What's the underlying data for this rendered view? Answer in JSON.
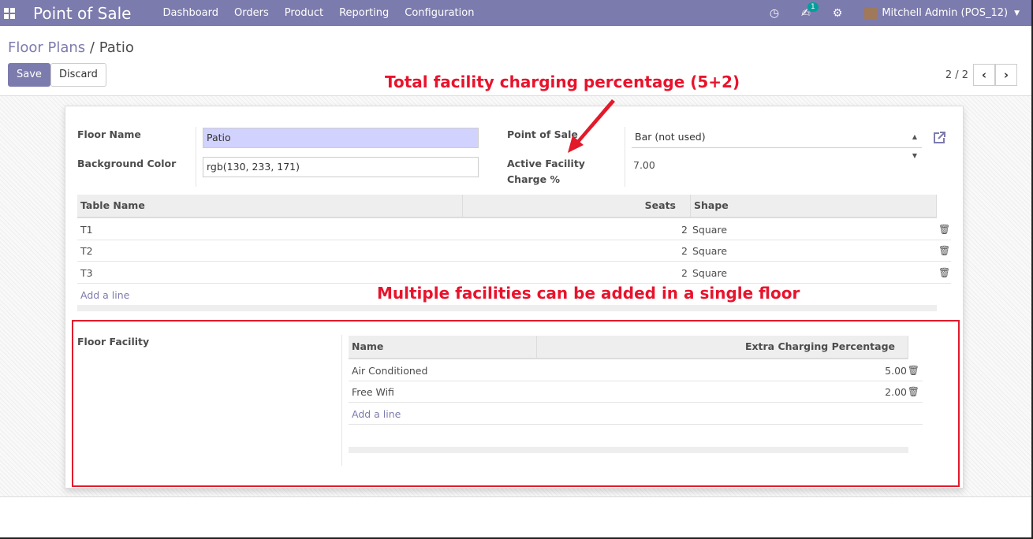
{
  "navbar": {
    "app_title": "Point of Sale",
    "menu": [
      "Dashboard",
      "Orders",
      "Product",
      "Reporting",
      "Configuration"
    ],
    "chat_badge": "1",
    "user": "Mitchell Admin (POS_12)"
  },
  "breadcrumb": {
    "parent": "Floor Plans",
    "separator": "/",
    "current": "Patio"
  },
  "buttons": {
    "save": "Save",
    "discard": "Discard"
  },
  "pager": {
    "value": "2 / 2"
  },
  "form": {
    "floor_name_label": "Floor Name",
    "floor_name_value": "Patio",
    "bg_color_label": "Background Color",
    "bg_color_value": "rgb(130, 233, 171)",
    "pos_label": "Point of Sale",
    "pos_value": "Bar (not used)",
    "active_facility_label_1": "Active Facility",
    "active_facility_label_2": "Charge %",
    "active_facility_value": "7.00",
    "floor_facility_label": "Floor Facility"
  },
  "tables": {
    "headers": {
      "name": "Table Name",
      "seats": "Seats",
      "shape": "Shape"
    },
    "rows": [
      {
        "name": "T1",
        "seats": "2",
        "shape": "Square"
      },
      {
        "name": "T2",
        "seats": "2",
        "shape": "Square"
      },
      {
        "name": "T3",
        "seats": "2",
        "shape": "Square"
      }
    ],
    "add_line": "Add a line"
  },
  "facilities": {
    "headers": {
      "name": "Name",
      "pct": "Extra Charging Percentage"
    },
    "rows": [
      {
        "name": "Air Conditioned",
        "pct": "5.00"
      },
      {
        "name": "Free Wifi",
        "pct": "2.00"
      }
    ],
    "add_line": "Add a line"
  },
  "annotations": {
    "top": "Total facility charging percentage (5+2)",
    "middle": "Multiple facilities can be added in a single floor",
    "color": "#e8132c"
  },
  "colors": {
    "brand": "#7c7bad",
    "required_field": "#d2d2ff"
  }
}
